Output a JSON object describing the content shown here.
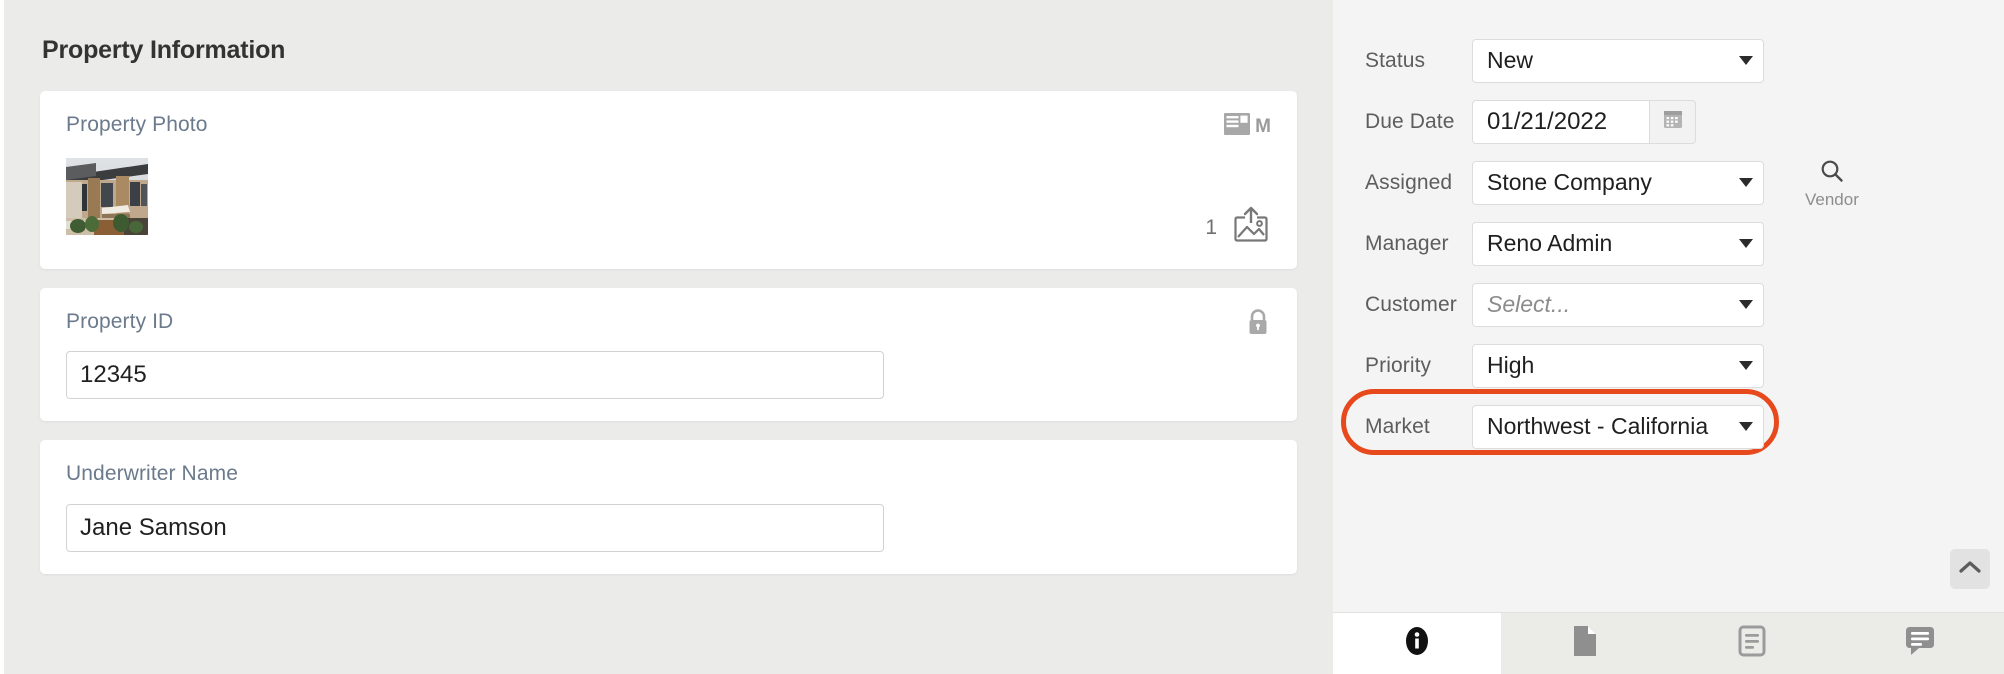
{
  "left_panel": {
    "section_title": "Property Information",
    "cards": [
      {
        "type": "photo",
        "label": "Property Photo",
        "corner_icon": "layout-thumbnail-icon",
        "corner_letter": "M",
        "upload_count": "1",
        "upload_icon": "image-upload-icon",
        "thumbnail_alt": "property-photo-thumbnail"
      },
      {
        "type": "text",
        "label": "Property ID",
        "value": "12345",
        "placeholder": "",
        "corner_icon": "lock-icon",
        "locked": true
      },
      {
        "type": "text",
        "label": "Underwriter Name",
        "value": "Jane Samson",
        "placeholder": "",
        "corner_icon": "",
        "locked": false
      }
    ]
  },
  "right_panel": {
    "rows": [
      {
        "label": "Status",
        "control": "select",
        "value": "New",
        "is_placeholder": false,
        "highlighted": false
      },
      {
        "label": "Due Date",
        "control": "date",
        "value": "01/21/2022",
        "is_placeholder": false,
        "highlighted": false,
        "button_icon": "calendar-icon"
      },
      {
        "label": "Assigned",
        "control": "select",
        "value": "Stone Company",
        "is_placeholder": false,
        "highlighted": false,
        "side_action_icon": "search-icon",
        "side_action_label": "Vendor"
      },
      {
        "label": "Manager",
        "control": "select",
        "value": "Reno Admin",
        "is_placeholder": false,
        "highlighted": false
      },
      {
        "label": "Customer",
        "control": "select",
        "value": "Select...",
        "is_placeholder": true,
        "highlighted": false
      },
      {
        "label": "Priority",
        "control": "select",
        "value": "High",
        "is_placeholder": false,
        "highlighted": false
      },
      {
        "label": "Market",
        "control": "select",
        "value": "Northwest - California",
        "is_placeholder": false,
        "highlighted": true
      }
    ],
    "collapse_icon": "chevron-up-icon",
    "tabs": [
      {
        "icon": "info-icon",
        "active": true
      },
      {
        "icon": "file-icon",
        "active": false
      },
      {
        "icon": "document-icon",
        "active": false
      },
      {
        "icon": "comment-icon",
        "active": false
      }
    ]
  },
  "colors": {
    "annotation_red": "#e8491c",
    "left_panel_bg": "#ebebea",
    "right_panel_bg": "#f4f4f4",
    "label_blue_grey": "#6b7a8c",
    "heading": "#333333"
  }
}
